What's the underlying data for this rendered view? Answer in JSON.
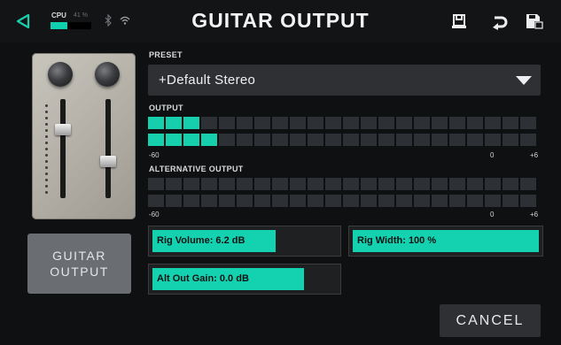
{
  "header": {
    "title": "GUITAR OUTPUT",
    "cpu_label": "CPU",
    "cpu_percent": "41 %",
    "cpu_level": 0.41,
    "accent": "#16cfac"
  },
  "side": {
    "device_icon": "amp-output-device",
    "button_label_line1": "GUITAR",
    "button_label_line2": "OUTPUT"
  },
  "preset": {
    "label": "PRESET",
    "value": "+Default Stereo"
  },
  "output": {
    "label": "OUTPUT",
    "row1_lit": 3,
    "row2_lit": 4,
    "scale_min": "-60",
    "scale_zero": "0",
    "scale_max": "+6"
  },
  "alt_output": {
    "label": "ALTERNATIVE OUTPUT",
    "row1_lit": 0,
    "row2_lit": 0,
    "scale_min": "-60",
    "scale_zero": "0",
    "scale_max": "+6"
  },
  "controls": {
    "rig_volume": {
      "label": "Rig Volume: 6.2 dB",
      "level": 0.67
    },
    "rig_width": {
      "label": "Rig Width: 100 %",
      "level": 1.0
    },
    "alt_out_gain": {
      "label": "Alt Out Gain: 0.0 dB",
      "level": 0.82
    }
  },
  "footer": {
    "cancel_label": "CANCEL"
  }
}
